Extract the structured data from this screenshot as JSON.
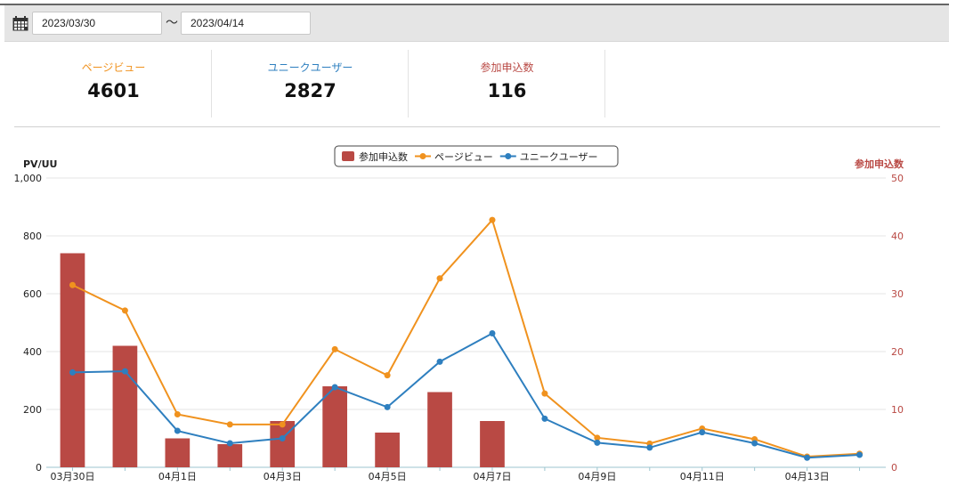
{
  "filter": {
    "date_from": "2023/03/30",
    "separator": "〜",
    "date_to": "2023/04/14"
  },
  "summary": [
    {
      "label": "ページビュー",
      "value": "4601",
      "color": "#f0921e"
    },
    {
      "label": "ユニークユーザー",
      "value": "2827",
      "color": "#2e7fbf"
    },
    {
      "label": "参加申込数",
      "value": "116",
      "color": "#b94944"
    }
  ],
  "icons": {
    "calendar": "calendar-icon"
  },
  "colors": {
    "bar": "#b94944",
    "pageviews": "#f0921e",
    "uniques": "#2e7fbf",
    "right_axis": "#b94944"
  },
  "chart_data": {
    "type": "bar+line",
    "x": [
      "03月30日",
      "03月31日",
      "04月1日",
      "04月2日",
      "04月3日",
      "04月4日",
      "04月5日",
      "04月6日",
      "04月7日",
      "04月8日",
      "04月9日",
      "04月10日",
      "04月11日",
      "04月12日",
      "04月13日",
      "04月14日"
    ],
    "x_tick_labels": [
      "03月30日",
      "",
      "04月1日",
      "",
      "04月3日",
      "",
      "04月5日",
      "",
      "04月7日",
      "",
      "04月9日",
      "",
      "04月11日",
      "",
      "04月13日",
      ""
    ],
    "left_axis": {
      "label": "PV/UU",
      "ylim": [
        0,
        1000
      ],
      "ticks": [
        "0",
        "200",
        "400",
        "600",
        "800",
        "1,000"
      ]
    },
    "right_axis": {
      "label": "参加申込数",
      "ylim": [
        0,
        50
      ],
      "ticks": [
        "0",
        "10",
        "20",
        "30",
        "40",
        "50"
      ]
    },
    "grid": true,
    "legend_position": "top-center",
    "series": [
      {
        "name": "参加申込数",
        "kind": "bar",
        "axis": "right",
        "values": [
          37,
          21,
          5,
          4,
          8,
          14,
          6,
          13,
          8,
          0,
          0,
          0,
          0,
          0,
          0,
          0
        ]
      },
      {
        "name": "ページビュー",
        "kind": "line",
        "axis": "left",
        "values": [
          630,
          542,
          183,
          148,
          148,
          408,
          318,
          653,
          855,
          255,
          102,
          82,
          134,
          97,
          37,
          47
        ]
      },
      {
        "name": "ユニークユーザー",
        "kind": "line",
        "axis": "left",
        "values": [
          328,
          332,
          126,
          83,
          100,
          277,
          208,
          365,
          463,
          168,
          85,
          68,
          121,
          83,
          33,
          43
        ]
      }
    ]
  }
}
